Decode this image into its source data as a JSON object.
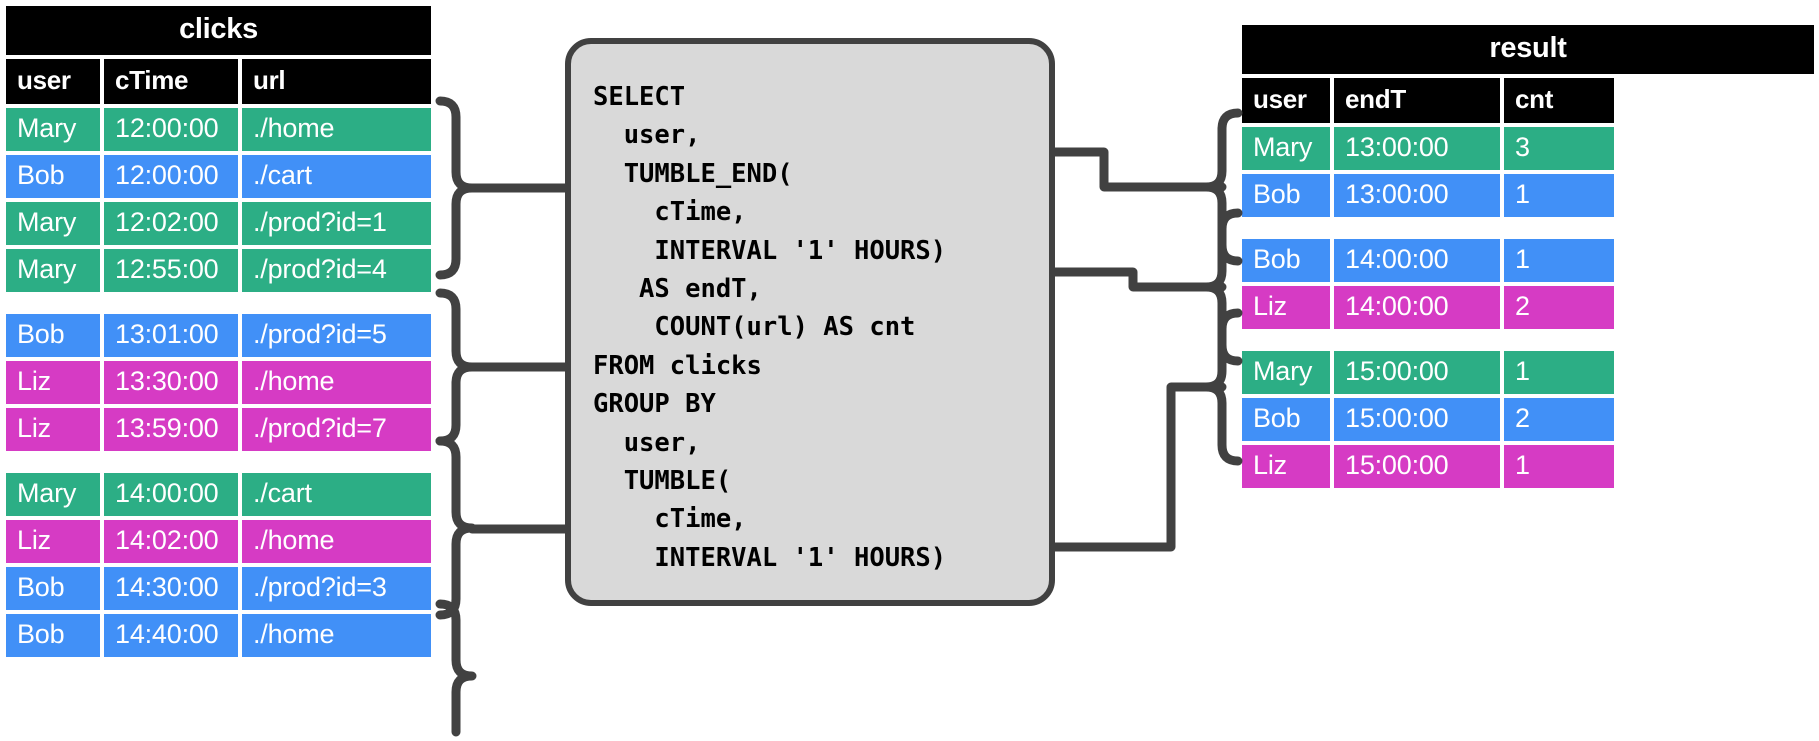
{
  "colors": {
    "green": "#2CAE85",
    "blue": "#4190F7",
    "magenta": "#D63BC4",
    "header_bg": "#000000",
    "header_fg": "#ffffff",
    "box_fill": "#d9d9d9",
    "box_stroke": "#414141"
  },
  "clicks": {
    "title": "clicks",
    "columns": [
      "user",
      "cTime",
      "url"
    ],
    "groups": [
      {
        "rows": [
          {
            "user": "Mary",
            "cTime": "12:00:00",
            "url": "./home",
            "color": "green"
          },
          {
            "user": "Bob",
            "cTime": "12:00:00",
            "url": "./cart",
            "color": "blue"
          },
          {
            "user": "Mary",
            "cTime": "12:02:00",
            "url": "./prod?id=1",
            "color": "green"
          },
          {
            "user": "Mary",
            "cTime": "12:55:00",
            "url": "./prod?id=4",
            "color": "green"
          }
        ]
      },
      {
        "rows": [
          {
            "user": "Bob",
            "cTime": "13:01:00",
            "url": "./prod?id=5",
            "color": "blue"
          },
          {
            "user": "Liz",
            "cTime": "13:30:00",
            "url": "./home",
            "color": "magenta"
          },
          {
            "user": "Liz",
            "cTime": "13:59:00",
            "url": "./prod?id=7",
            "color": "magenta"
          }
        ]
      },
      {
        "rows": [
          {
            "user": "Mary",
            "cTime": "14:00:00",
            "url": "./cart",
            "color": "green"
          },
          {
            "user": "Liz",
            "cTime": "14:02:00",
            "url": "./home",
            "color": "magenta"
          },
          {
            "user": "Bob",
            "cTime": "14:30:00",
            "url": "./prod?id=3",
            "color": "blue"
          },
          {
            "user": "Bob",
            "cTime": "14:40:00",
            "url": "./home",
            "color": "blue"
          }
        ]
      }
    ]
  },
  "sql": {
    "query": "SELECT\n  user,\n  TUMBLE_END(\n    cTime,\n    INTERVAL '1' HOURS)\n   AS endT,\n    COUNT(url) AS cnt\nFROM clicks\nGROUP BY\n  user,\n  TUMBLE(\n    cTime,\n    INTERVAL '1' HOURS)"
  },
  "result": {
    "title": "result",
    "columns": [
      "user",
      "endT",
      "cnt"
    ],
    "groups": [
      {
        "rows": [
          {
            "user": "Mary",
            "endT": "13:00:00",
            "cnt": "3",
            "color": "green"
          },
          {
            "user": "Bob",
            "endT": "13:00:00",
            "cnt": "1",
            "color": "blue"
          }
        ]
      },
      {
        "rows": [
          {
            "user": "Bob",
            "endT": "14:00:00",
            "cnt": "1",
            "color": "blue"
          },
          {
            "user": "Liz",
            "endT": "14:00:00",
            "cnt": "2",
            "color": "magenta"
          }
        ]
      },
      {
        "rows": [
          {
            "user": "Mary",
            "endT": "15:00:00",
            "cnt": "1",
            "color": "green"
          },
          {
            "user": "Bob",
            "endT": "15:00:00",
            "cnt": "2",
            "color": "blue"
          },
          {
            "user": "Liz",
            "endT": "15:00:00",
            "cnt": "1",
            "color": "magenta"
          }
        ]
      }
    ]
  }
}
